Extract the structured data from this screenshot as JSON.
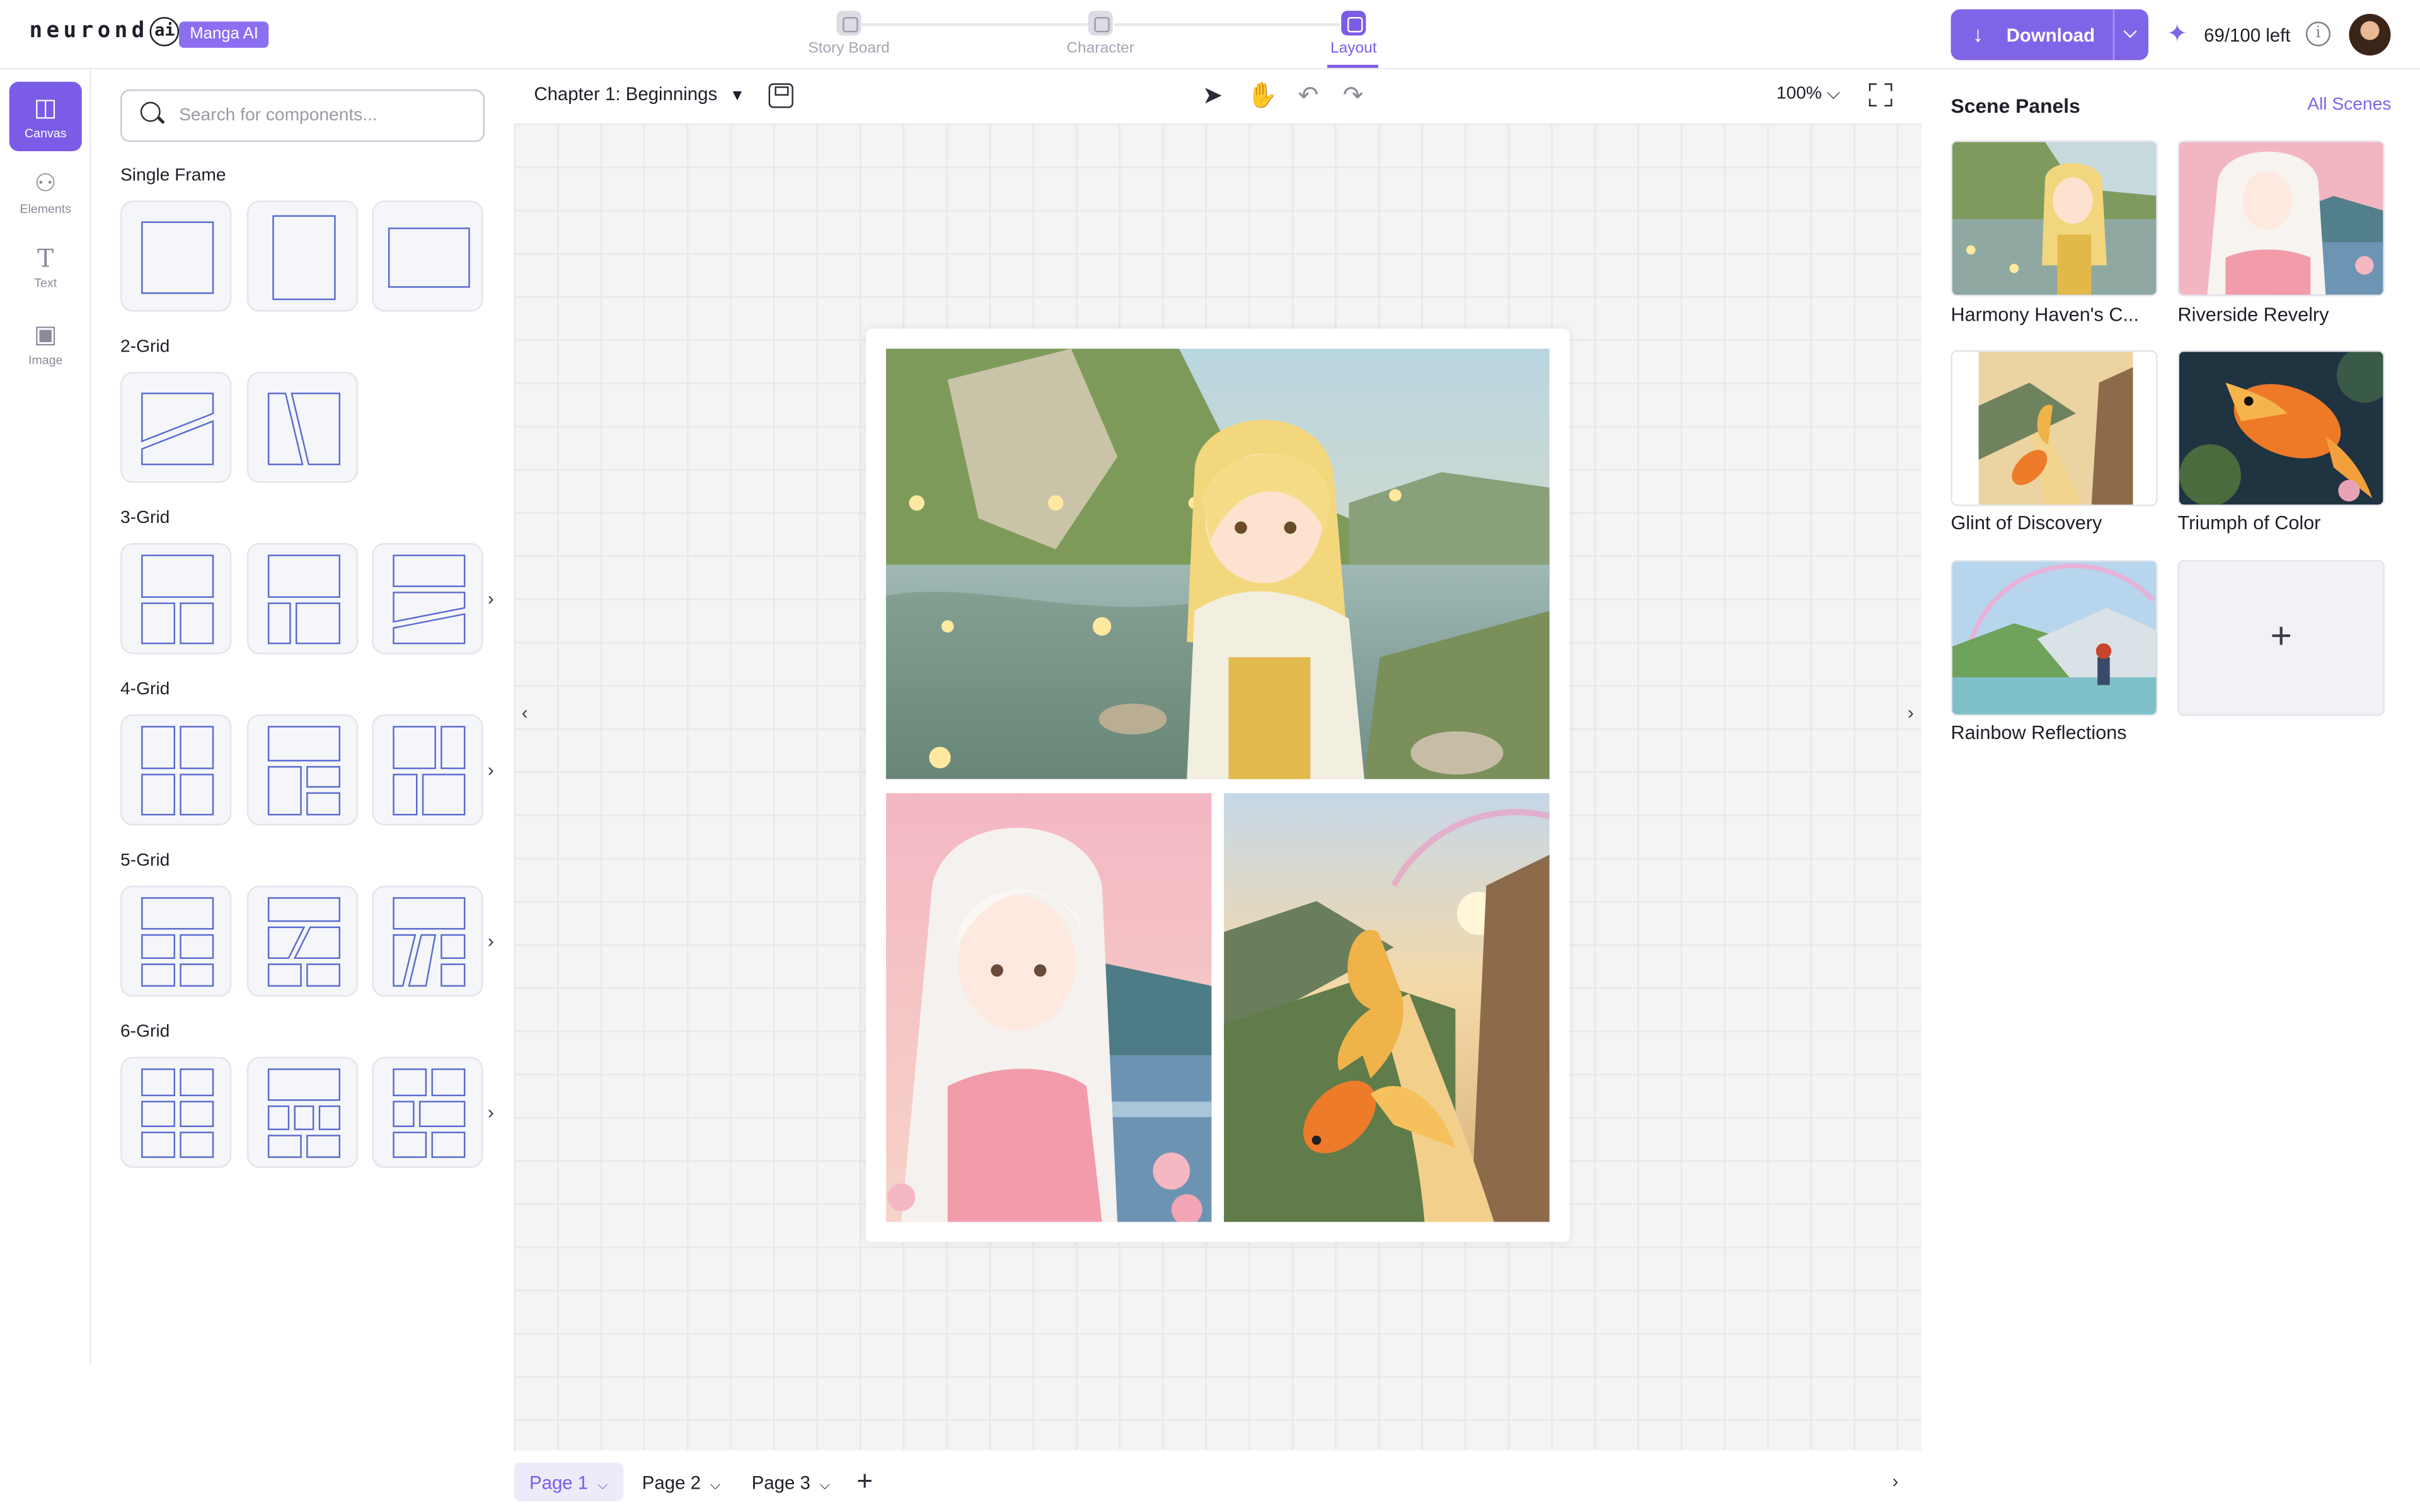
{
  "app": {
    "logo": "neurond",
    "logo_ai": "ai",
    "badge": "Manga AI"
  },
  "steps": [
    {
      "label": "Story Board",
      "active": false
    },
    {
      "label": "Character",
      "active": false
    },
    {
      "label": "Layout",
      "active": true
    }
  ],
  "header": {
    "download_label": "Download",
    "credits": "69/100 left",
    "accent": "#8064e8"
  },
  "rail": [
    {
      "label": "Canvas",
      "icon": "layout-icon",
      "active": true
    },
    {
      "label": "Elements",
      "icon": "shapes-icon",
      "active": false
    },
    {
      "label": "Text",
      "icon": "text-icon",
      "active": false
    },
    {
      "label": "Image",
      "icon": "image-icon",
      "active": false
    }
  ],
  "components": {
    "search_placeholder": "Search for components...",
    "sections": [
      "Single Frame",
      "2-Grid",
      "3-Grid",
      "4-Grid",
      "5-Grid",
      "6-Grid"
    ]
  },
  "toolbar": {
    "chapter": "Chapter 1: Beginnings",
    "zoom": "100%"
  },
  "scene_panels": {
    "title": "Scene Panels",
    "all_link": "All Scenes",
    "items": [
      "Harmony Haven's C...",
      "Riverside Revelry",
      "Glint of Discovery",
      "Triumph of Color",
      "Rainbow Reflections"
    ],
    "add_symbol": "+"
  },
  "pages": {
    "tabs": [
      "Page 1",
      "Page 2",
      "Page 3"
    ],
    "active": "Page 1",
    "add_symbol": "+"
  }
}
